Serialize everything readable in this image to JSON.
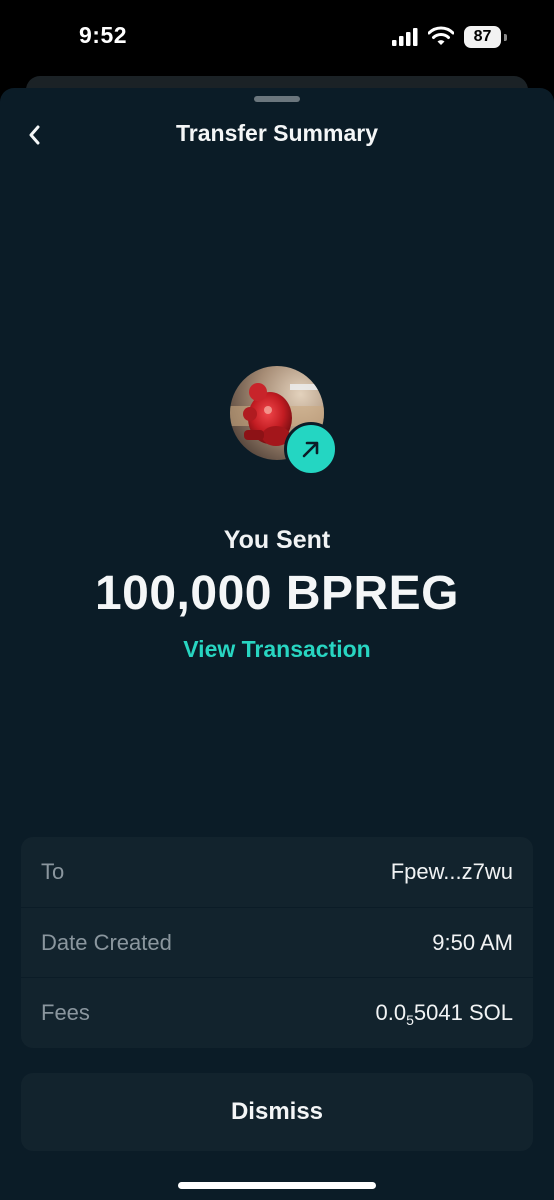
{
  "status_bar": {
    "time": "9:52",
    "battery": "87"
  },
  "header": {
    "title": "Transfer Summary"
  },
  "summary": {
    "label": "You Sent",
    "amount": "100,000 BPREG",
    "view_link": "View Transaction"
  },
  "details": {
    "to": {
      "label": "To",
      "value": "Fpew...z7wu"
    },
    "date": {
      "label": "Date Created",
      "value": "9:50 AM"
    },
    "fees": {
      "label": "Fees",
      "value_prefix": "0.0",
      "value_subscript": "5",
      "value_suffix": "5041 SOL"
    }
  },
  "actions": {
    "dismiss_label": "Dismiss"
  },
  "colors": {
    "accent": "#28d5c1",
    "sheet_bg": "#0b1c27",
    "card_bg": "#12232d"
  }
}
